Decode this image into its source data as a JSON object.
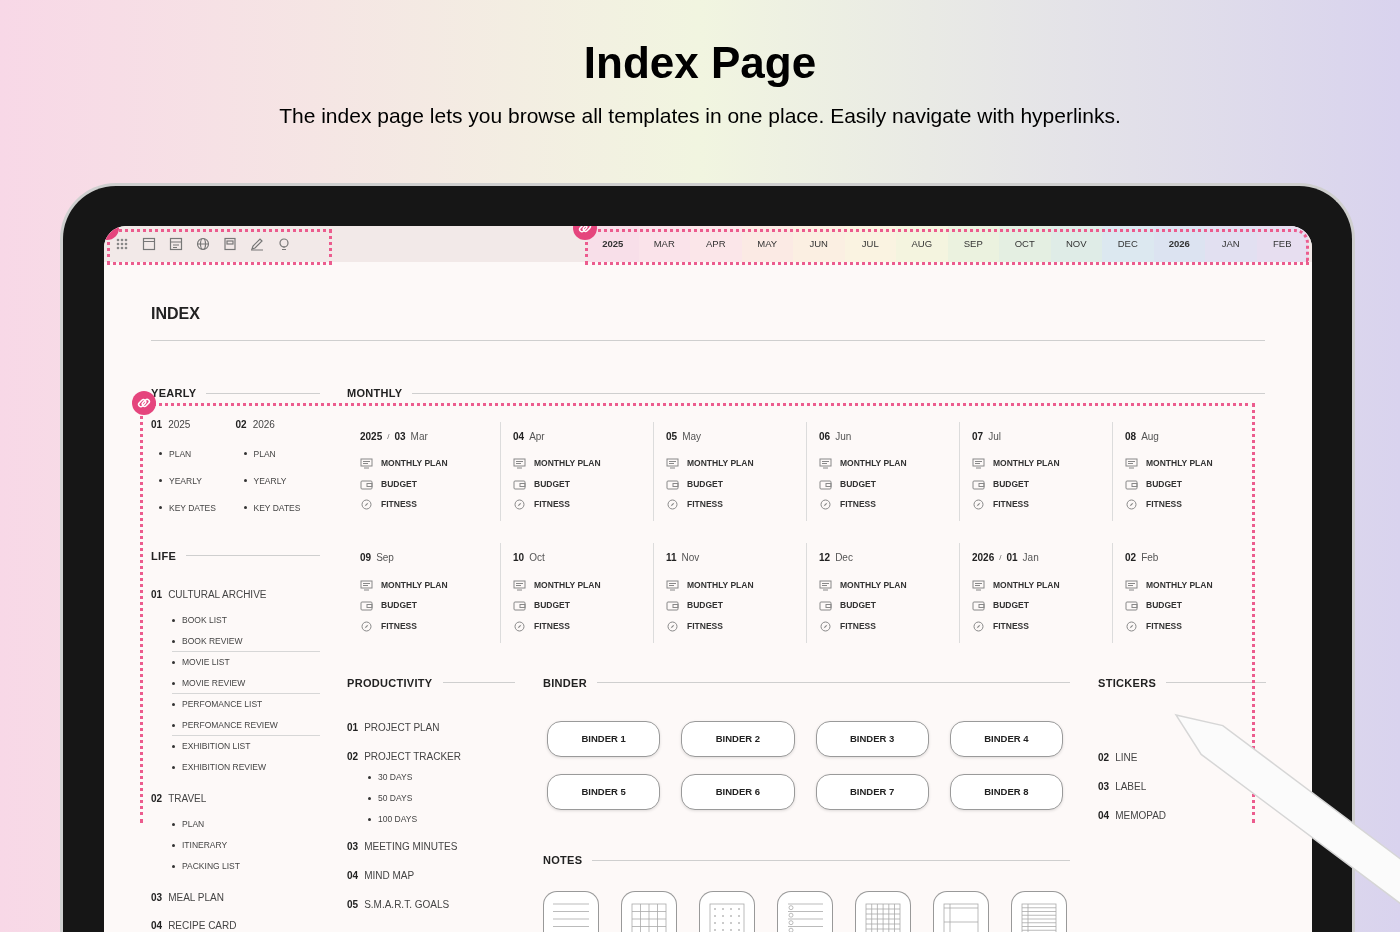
{
  "header": {
    "title": "Index Page",
    "subtitle": "The index page lets you browse all templates in one place. Easily navigate with hyperlinks."
  },
  "month_tabs": [
    {
      "label": "2025",
      "kind": "year",
      "color": "#f8dfe9"
    },
    {
      "label": "MAR",
      "kind": "month",
      "color": "#fae3ea"
    },
    {
      "label": "APR",
      "kind": "month",
      "color": "#fbe6e9"
    },
    {
      "label": "MAY",
      "kind": "month",
      "color": "#fbeae4"
    },
    {
      "label": "JUN",
      "kind": "month",
      "color": "#fbefe2"
    },
    {
      "label": "JUL",
      "kind": "month",
      "color": "#faf3e1"
    },
    {
      "label": "AUG",
      "kind": "month",
      "color": "#f4f4df"
    },
    {
      "label": "SEP",
      "kind": "month",
      "color": "#ebf2df"
    },
    {
      "label": "OCT",
      "kind": "month",
      "color": "#e4efe2"
    },
    {
      "label": "NOV",
      "kind": "month",
      "color": "#dfece7"
    },
    {
      "label": "DEC",
      "kind": "month",
      "color": "#dce8f0"
    },
    {
      "label": "2026",
      "kind": "year",
      "color": "#dce3f1"
    },
    {
      "label": "JAN",
      "kind": "month",
      "color": "#e2e0f1"
    },
    {
      "label": "FEB",
      "kind": "month",
      "color": "#e7def0"
    }
  ],
  "index_title": "INDEX",
  "yearly": {
    "heading": "YEARLY",
    "years": [
      {
        "number": "01",
        "label": "2025",
        "items": [
          "PLAN",
          "YEARLY",
          "KEY DATES"
        ]
      },
      {
        "number": "02",
        "label": "2026",
        "items": [
          "PLAN",
          "YEARLY",
          "KEY DATES"
        ]
      }
    ]
  },
  "life": {
    "heading": "LIFE",
    "items": [
      {
        "number": "01",
        "label": "CULTURAL ARCHIVE",
        "children": [
          {
            "label": "BOOK LIST",
            "rule_below": false
          },
          {
            "label": "BOOK REVIEW",
            "rule_below": true
          },
          {
            "label": "MOVIE LIST",
            "rule_below": false
          },
          {
            "label": "MOVIE REVIEW",
            "rule_below": true
          },
          {
            "label": "PERFOMANCE LIST",
            "rule_below": false
          },
          {
            "label": "PERFOMANCE REVIEW",
            "rule_below": true
          },
          {
            "label": "EXHIBITION LIST",
            "rule_below": false
          },
          {
            "label": "EXHIBITION REVIEW",
            "rule_below": false
          }
        ]
      },
      {
        "number": "02",
        "label": "TRAVEL",
        "children": [
          {
            "label": "PLAN",
            "rule_below": false
          },
          {
            "label": "ITINERARY",
            "rule_below": false
          },
          {
            "label": "PACKING LIST",
            "rule_below": false
          }
        ]
      },
      {
        "number": "03",
        "label": "MEAL PLAN"
      },
      {
        "number": "04",
        "label": "RECIPE CARD"
      }
    ]
  },
  "monthly": {
    "heading": "MONTHLY",
    "months": [
      {
        "year": "2025",
        "separator": "/",
        "number": "03",
        "label": "Mar",
        "links": [
          {
            "kind": "plan",
            "label": "MONTHLY PLAN"
          },
          {
            "kind": "budget",
            "label": "BUDGET"
          },
          {
            "kind": "fitness",
            "label": "FITNESS"
          }
        ]
      },
      {
        "number": "04",
        "label": "Apr",
        "links": [
          {
            "kind": "plan",
            "label": "MONTHLY PLAN"
          },
          {
            "kind": "budget",
            "label": "BUDGET"
          },
          {
            "kind": "fitness",
            "label": "FITNESS"
          }
        ]
      },
      {
        "number": "05",
        "label": "May",
        "links": [
          {
            "kind": "plan",
            "label": "MONTHLY PLAN"
          },
          {
            "kind": "budget",
            "label": "BUDGET"
          },
          {
            "kind": "fitness",
            "label": "FITNESS"
          }
        ]
      },
      {
        "number": "06",
        "label": "Jun",
        "links": [
          {
            "kind": "plan",
            "label": "MONTHLY PLAN"
          },
          {
            "kind": "budget",
            "label": "BUDGET"
          },
          {
            "kind": "fitness",
            "label": "FITNESS"
          }
        ]
      },
      {
        "number": "07",
        "label": "Jul",
        "links": [
          {
            "kind": "plan",
            "label": "MONTHLY PLAN"
          },
          {
            "kind": "budget",
            "label": "BUDGET"
          },
          {
            "kind": "fitness",
            "label": "FITNESS"
          }
        ]
      },
      {
        "number": "08",
        "label": "Aug",
        "links": [
          {
            "kind": "plan",
            "label": "MONTHLY PLAN"
          },
          {
            "kind": "budget",
            "label": "BUDGET"
          },
          {
            "kind": "fitness",
            "label": "FITNESS"
          }
        ]
      },
      {
        "number": "09",
        "label": "Sep",
        "links": [
          {
            "kind": "plan",
            "label": "MONTHLY PLAN"
          },
          {
            "kind": "budget",
            "label": "BUDGET"
          },
          {
            "kind": "fitness",
            "label": "FITNESS"
          }
        ]
      },
      {
        "number": "10",
        "label": "Oct",
        "links": [
          {
            "kind": "plan",
            "label": "MONTHLY PLAN"
          },
          {
            "kind": "budget",
            "label": "BUDGET"
          },
          {
            "kind": "fitness",
            "label": "FITNESS"
          }
        ]
      },
      {
        "number": "11",
        "label": "Nov",
        "links": [
          {
            "kind": "plan",
            "label": "MONTHLY PLAN"
          },
          {
            "kind": "budget",
            "label": "BUDGET"
          },
          {
            "kind": "fitness",
            "label": "FITNESS"
          }
        ]
      },
      {
        "number": "12",
        "label": "Dec",
        "links": [
          {
            "kind": "plan",
            "label": "MONTHLY PLAN"
          },
          {
            "kind": "budget",
            "label": "BUDGET"
          },
          {
            "kind": "fitness",
            "label": "FITNESS"
          }
        ]
      },
      {
        "year": "2026",
        "separator": "/",
        "number": "01",
        "label": "Jan",
        "links": [
          {
            "kind": "plan",
            "label": "MONTHLY PLAN"
          },
          {
            "kind": "budget",
            "label": "BUDGET"
          },
          {
            "kind": "fitness",
            "label": "FITNESS"
          }
        ]
      },
      {
        "number": "02",
        "label": "Feb",
        "links": [
          {
            "kind": "plan",
            "label": "MONTHLY PLAN"
          },
          {
            "kind": "budget",
            "label": "BUDGET"
          },
          {
            "kind": "fitness",
            "label": "FITNESS"
          }
        ]
      }
    ]
  },
  "productivity": {
    "heading": "PRODUCTIVITY",
    "items": [
      {
        "number": "01",
        "label": "PROJECT PLAN"
      },
      {
        "number": "02",
        "label": "PROJECT TRACKER",
        "children": [
          "30 DAYS",
          "50 DAYS",
          "100 DAYS"
        ]
      },
      {
        "number": "03",
        "label": "MEETING MINUTES"
      },
      {
        "number": "04",
        "label": "MIND MAP"
      },
      {
        "number": "05",
        "label": "S.M.A.R.T. GOALS"
      }
    ]
  },
  "binder": {
    "heading": "BINDER",
    "buttons": [
      "BINDER 1",
      "BINDER 2",
      "BINDER 3",
      "BINDER 4",
      "BINDER 5",
      "BINDER 6",
      "BINDER 7",
      "BINDER 8"
    ]
  },
  "notes": {
    "heading": "NOTES",
    "templates": [
      {
        "kind": "lined"
      },
      {
        "kind": "grid"
      },
      {
        "kind": "dotted"
      },
      {
        "kind": "checklist"
      },
      {
        "kind": "fine-grid"
      },
      {
        "kind": "cornell"
      },
      {
        "kind": "table"
      }
    ]
  },
  "stickers": {
    "heading": "STICKERS",
    "items": [
      {
        "number": "02",
        "label": "LINE"
      },
      {
        "number": "03",
        "label": "LABEL"
      },
      {
        "number": "04",
        "label": "MEMOPAD"
      }
    ]
  }
}
